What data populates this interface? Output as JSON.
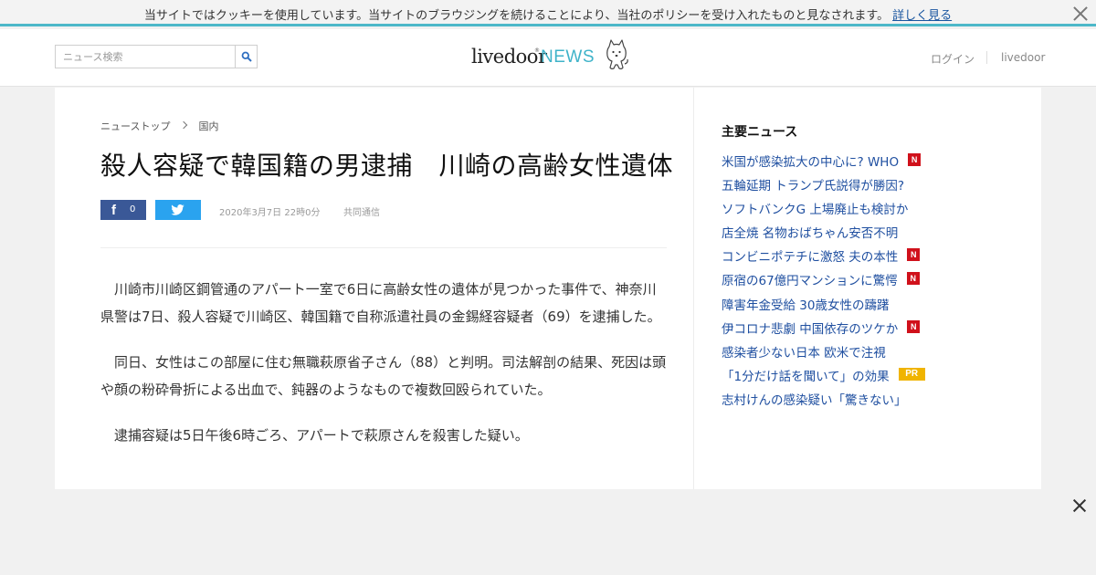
{
  "cookie_bar": {
    "text": "当サイトではクッキーを使用しています。当サイトのブラウジングを続けることにより、当社のポリシーを受け入れたものと見なされます。",
    "link": "詳しく見る"
  },
  "header": {
    "search_placeholder": "ニュース検索",
    "logo_text": "livedoor",
    "logo_reg": "®",
    "logo_news": "NEWS",
    "login": "ログイン",
    "livedoor": "livedoor"
  },
  "breadcrumb": {
    "top": "ニューストップ",
    "category": "国内"
  },
  "article": {
    "title": "殺人容疑で韓国籍の男逮捕　川崎の高齢女性遺体",
    "fb_count": "0",
    "date": "2020年3月7日 22時0分",
    "source": "共同通信",
    "paragraphs": [
      "川崎市川崎区鋼管通のアパート一室で6日に高齢女性の遺体が見つかった事件で、神奈川県警は7日、殺人容疑で川崎区、韓国籍で自称派遣社員の金錫経容疑者（69）を逮捕した。",
      "同日、女性はこの部屋に住む無職萩原省子さん（88）と判明。司法解剖の結果、死因は頭や顔の粉砕骨折による出血で、鈍器のようなもので複数回殴られていた。",
      "逮捕容疑は5日午後6時ごろ、アパートで萩原さんを殺害した疑い。"
    ]
  },
  "sidebar": {
    "heading": "主要ニュース",
    "items": [
      {
        "label": "米国が感染拡大の中心に? WHO",
        "badge": "N"
      },
      {
        "label": "五輪延期 トランプ氏説得が勝因?",
        "badge": ""
      },
      {
        "label": "ソフトバンクG 上場廃止も検討か",
        "badge": ""
      },
      {
        "label": "店全焼 名物おばちゃん安否不明",
        "badge": ""
      },
      {
        "label": "コンビニポテチに激怒 夫の本性",
        "badge": "N"
      },
      {
        "label": "原宿の67億円マンションに驚愕",
        "badge": "N"
      },
      {
        "label": "障害年金受給 30歳女性の躊躇",
        "badge": ""
      },
      {
        "label": "伊コロナ悲劇 中国依存のツケか",
        "badge": "N"
      },
      {
        "label": "感染者少ない日本 欧米で注視",
        "badge": ""
      },
      {
        "label": "「1分だけ話を聞いて」の効果",
        "badge": "PR"
      },
      {
        "label": "志村けんの感染疑い「驚きない」",
        "badge": ""
      }
    ]
  },
  "colors": {
    "accent": "#4db8c9",
    "link": "#1f4fa0",
    "facebook": "#3a5897",
    "twitter": "#2aa3ef",
    "badge_new": "#d0111b",
    "badge_pr": "#f0b400"
  }
}
